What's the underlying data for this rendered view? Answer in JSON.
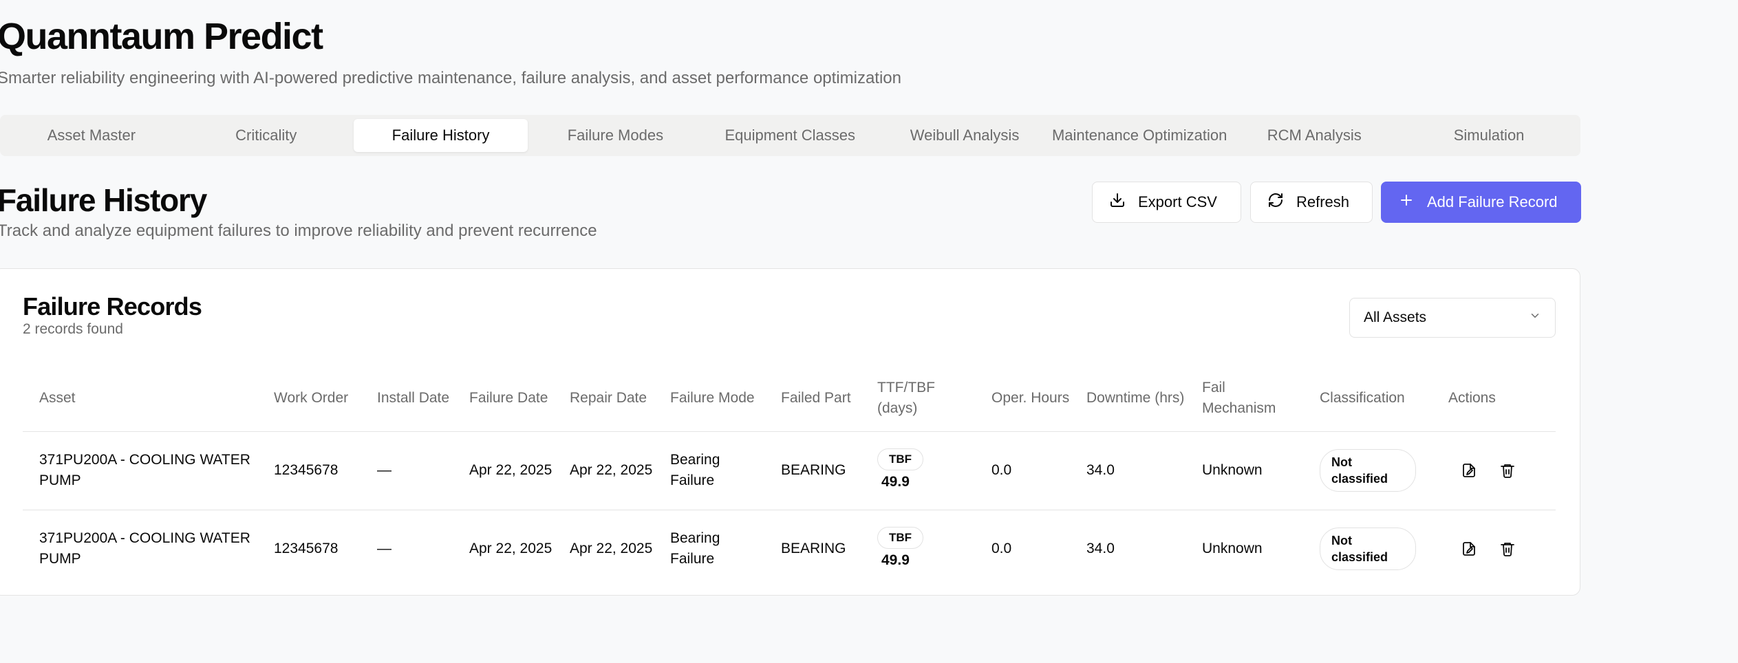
{
  "app": {
    "title": "Quanntaum Predict",
    "subtitle": "Smarter reliability engineering with AI-powered predictive maintenance, failure analysis, and asset performance optimization"
  },
  "tabs": [
    {
      "label": "Asset Master",
      "active": false
    },
    {
      "label": "Criticality",
      "active": false
    },
    {
      "label": "Failure History",
      "active": true
    },
    {
      "label": "Failure Modes",
      "active": false
    },
    {
      "label": "Equipment Classes",
      "active": false
    },
    {
      "label": "Weibull Analysis",
      "active": false
    },
    {
      "label": "Maintenance Optimization",
      "active": false
    },
    {
      "label": "RCM Analysis",
      "active": false
    },
    {
      "label": "Simulation",
      "active": false
    }
  ],
  "section": {
    "title": "Failure History",
    "subtitle": "Track and analyze equipment failures to improve reliability and prevent recurrence"
  },
  "toolbar": {
    "export_label": "Export CSV",
    "export_icon": "download-icon",
    "refresh_label": "Refresh",
    "refresh_icon": "refresh-icon",
    "add_label": "Add Failure Record",
    "add_icon": "plus-icon",
    "accent_color": "#6366f1"
  },
  "card": {
    "title": "Failure Records",
    "count": "2 records found",
    "filter": {
      "selected": "All Assets"
    }
  },
  "table": {
    "headers": {
      "asset": "Asset",
      "work_order": "Work Order",
      "install_date": "Install Date",
      "failure_date": "Failure Date",
      "repair_date": "Repair Date",
      "failure_mode": "Failure Mode",
      "failed_part": "Failed Part",
      "ttf": "TTF/TBF (days)",
      "oper_hours": "Oper. Hours",
      "downtime": "Downtime (hrs)",
      "fail_mechanism": "Fail Mechanism",
      "classification": "Classification",
      "actions": "Actions"
    },
    "rows": [
      {
        "asset": "371PU200A - COOLING WATER PUMP",
        "work_order": "12345678",
        "install_date": "—",
        "failure_date": "Apr 22, 2025",
        "repair_date": "Apr 22, 2025",
        "failure_mode": "Bearing Failure",
        "failed_part": "BEARING",
        "ttf_type": "TBF",
        "ttf_value": "49.9",
        "oper_hours": "0.0",
        "downtime": "34.0",
        "fail_mechanism": "Unknown",
        "classification": "Not classified"
      },
      {
        "asset": "371PU200A - COOLING WATER PUMP",
        "work_order": "12345678",
        "install_date": "—",
        "failure_date": "Apr 22, 2025",
        "repair_date": "Apr 22, 2025",
        "failure_mode": "Bearing Failure",
        "failed_part": "BEARING",
        "ttf_type": "TBF",
        "ttf_value": "49.9",
        "oper_hours": "0.0",
        "downtime": "34.0",
        "fail_mechanism": "Unknown",
        "classification": "Not classified"
      }
    ]
  }
}
